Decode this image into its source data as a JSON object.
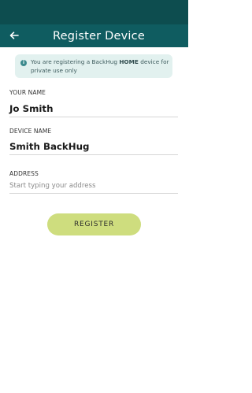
{
  "header": {
    "title": "Register Device",
    "back_icon": "arrow-left-icon"
  },
  "info_banner": {
    "icon": "info-icon",
    "text_before": "You are registering a BackHug ",
    "text_bold": "HOME",
    "text_after": " device for private use only"
  },
  "form": {
    "your_name": {
      "label": "YOUR NAME",
      "value": "Jo Smith"
    },
    "device_name": {
      "label": "DEVICE NAME",
      "value": "Smith BackHug"
    },
    "address": {
      "label": "ADDRESS",
      "placeholder": "Start typing your address"
    }
  },
  "register_button": {
    "label": "REGISTER"
  },
  "colors": {
    "status_bar": "#0d4d4f",
    "app_bar": "#0f5c60",
    "banner_bg": "#e2f1ef",
    "button_bg": "#cedd7e"
  }
}
